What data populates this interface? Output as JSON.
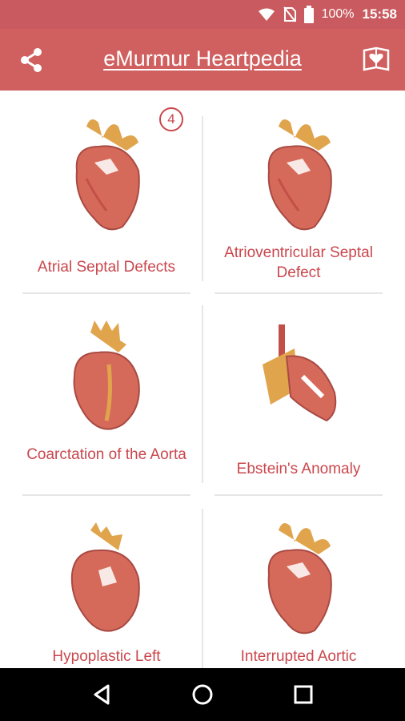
{
  "status": {
    "battery": "100%",
    "time": "15:58"
  },
  "appbar": {
    "title": "eMurmur Heartpedia"
  },
  "badge": {
    "count": "4"
  },
  "items": [
    {
      "label": "Atrial Septal Defects"
    },
    {
      "label": "Atrioventricular Septal Defect"
    },
    {
      "label": "Coarctation of the Aorta"
    },
    {
      "label": "Ebstein's Anomaly"
    },
    {
      "label": "Hypoplastic Left"
    },
    {
      "label": "Interrupted Aortic"
    }
  ],
  "icons": {
    "share": "share-icon",
    "book": "heart-book-icon",
    "back": "back-icon",
    "home": "home-icon",
    "recents": "recents-icon"
  },
  "colors": {
    "primary": "#d0605f",
    "accent": "#c9474d"
  }
}
